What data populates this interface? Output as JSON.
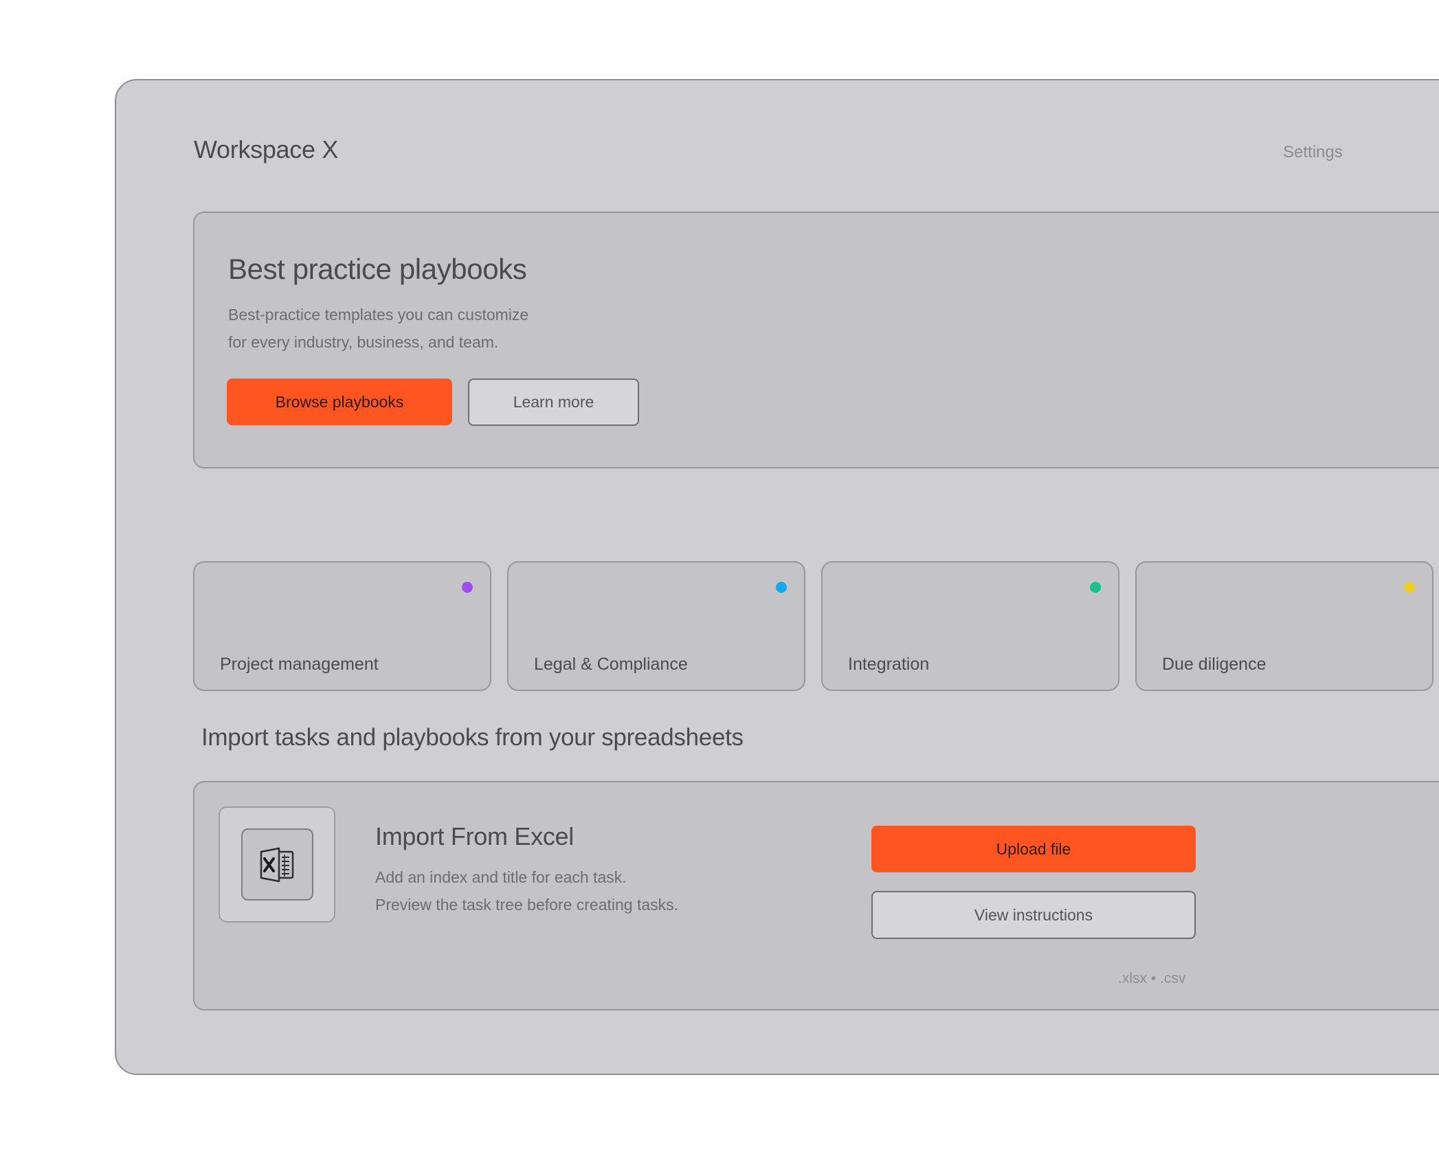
{
  "app": {
    "title": "Workspace X",
    "settings_label": "Settings"
  },
  "hero": {
    "title": "Best practice playbooks",
    "description_line1": "Best-practice templates you can customize",
    "description_line2": "for every industry, business, and team.",
    "primary_button": "Browse playbooks",
    "secondary_button": "Learn more"
  },
  "categories": [
    {
      "label": "Project management",
      "dot_color": "#a14cf0"
    },
    {
      "label": "Legal & Compliance",
      "dot_color": "#12a9ee"
    },
    {
      "label": "Integration",
      "dot_color": "#13c28c"
    },
    {
      "label": "Due diligence",
      "dot_color": "#f0cd25"
    }
  ],
  "import": {
    "heading": "Import tasks and playbooks from your spreadsheets",
    "title": "Import From Excel",
    "icon": "excel-icon",
    "description_line1": "Add an index and title for each task.",
    "description_line2": "Preview the task tree before creating tasks.",
    "upload_button": "Upload file",
    "instructions_button": "View instructions",
    "formats": ".xlsx • .csv"
  },
  "colors": {
    "accent": "#ff5520",
    "window_bg": "#cfced3",
    "card_bg": "#c4c3c8"
  }
}
